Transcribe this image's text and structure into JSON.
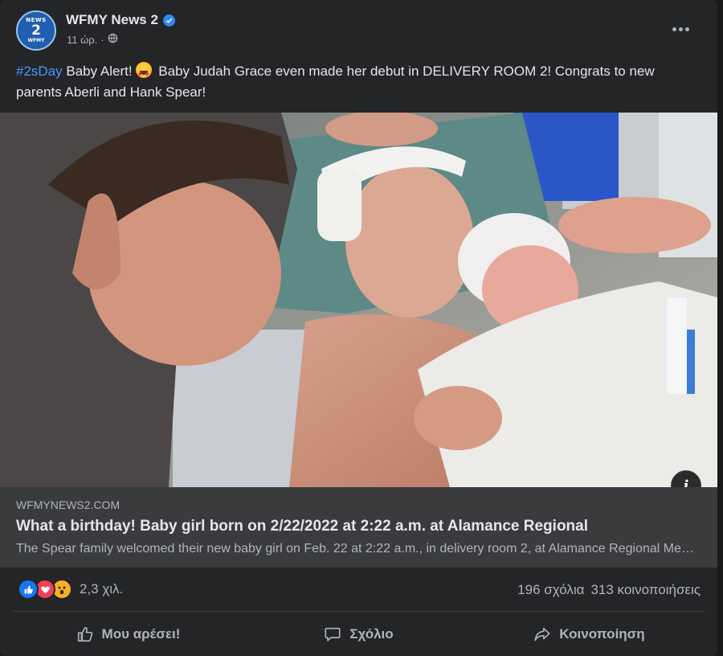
{
  "post": {
    "page_name": "WFMY News 2",
    "avatar_text": {
      "top": "NEWS",
      "middle": "2",
      "bottom": "WFMY"
    },
    "timestamp": "11 ώρ.",
    "separator": "·",
    "audience_icon": "globe-icon",
    "text": {
      "hashtag": "#2sDay",
      "part1": " Baby Alert!",
      "emoji": "star-struck-emoji",
      "part2": " Baby Judah Grace even made her debut in DELIVERY ROOM 2! Congrats to new parents Aberli and Hank Spear!"
    }
  },
  "photo": {
    "subject": "photo"
  },
  "link_preview": {
    "domain": "WFMYNEWS2.COM",
    "title": "What a birthday! Baby girl born on 2/22/2022 at 2:22 a.m. at Alamance Regional",
    "description": "The Spear family welcomed their new baby girl on Feb. 22 at 2:22 a.m., in delivery room 2, at Alamance Regional Medical Center."
  },
  "engagement": {
    "reactions": [
      "like-reaction",
      "love-reaction",
      "wow-reaction"
    ],
    "reaction_count": "2,3 χιλ.",
    "comments": "196 σχόλια",
    "shares": "313 κοινοποιήσεις"
  },
  "actions": {
    "like": "Μου αρέσει!",
    "comment": "Σχόλιο",
    "share": "Κοινοποίηση"
  },
  "colors": {
    "background": "#18191a",
    "card": "#242526",
    "link_box": "#3a3b3c",
    "hashtag": "#4599ff",
    "verified": "#2d88ff",
    "like": "#1877f2",
    "love": "#f33e58",
    "wow": "#f7b125"
  }
}
